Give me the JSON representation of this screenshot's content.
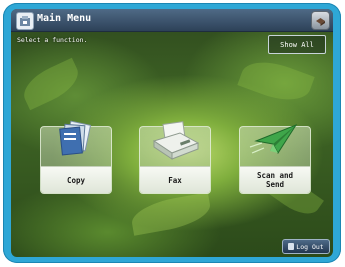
{
  "header": {
    "title": "Main Menu"
  },
  "instruction": "Select a function.",
  "show_all_label": "Show All",
  "functions": [
    {
      "label": "Copy",
      "icon": "copy-icon"
    },
    {
      "label": "Fax",
      "icon": "fax-icon"
    },
    {
      "label": "Scan and\nSend",
      "icon": "scan-send-icon"
    }
  ],
  "footer": {
    "logout_label": "Log Out"
  },
  "colors": {
    "frame": "#2ea7d6",
    "titlebar": "#2d4158",
    "background": "#3f6525"
  }
}
